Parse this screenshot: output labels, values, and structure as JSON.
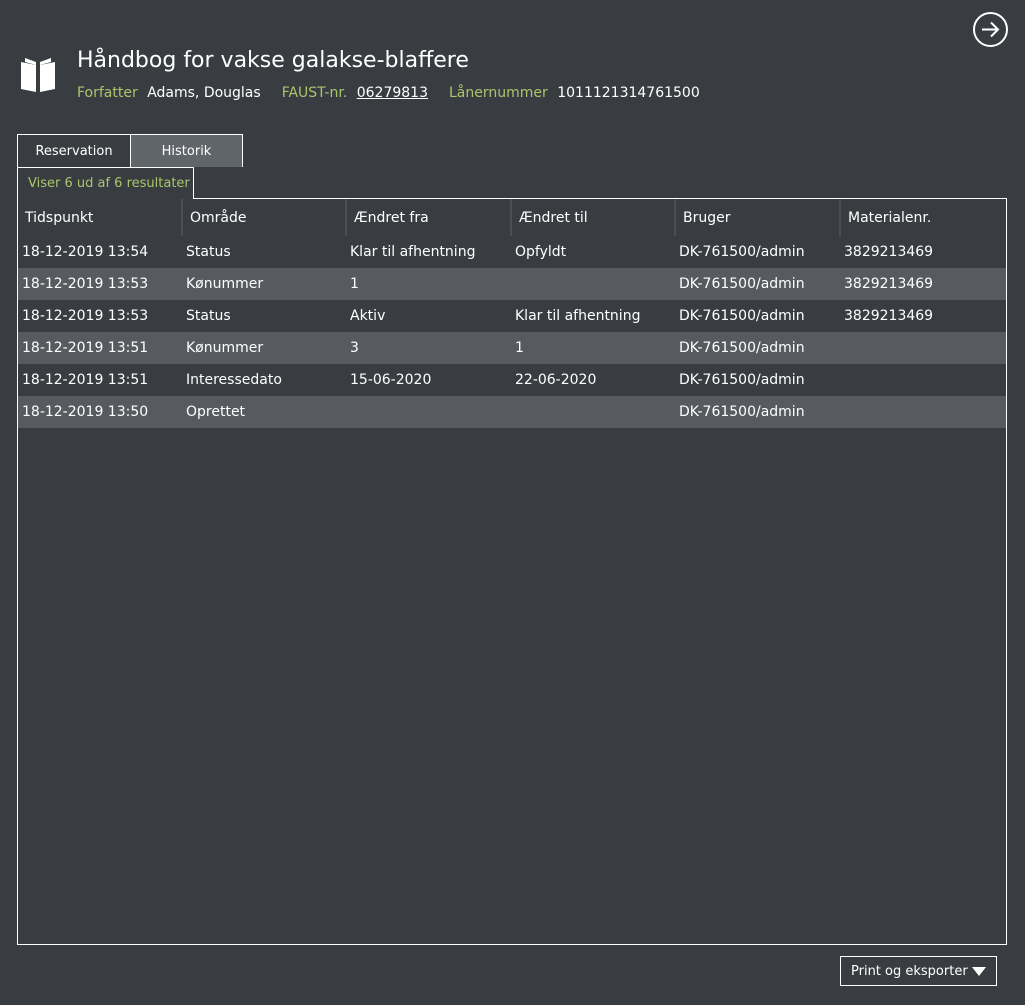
{
  "header": {
    "title": "Håndbog for vakse galakse-blaffere",
    "author_label": "Forfatter",
    "author_value": "Adams, Douglas",
    "faust_label": "FAUST-nr.",
    "faust_value": "06279813",
    "borrower_label": "Lånernummer",
    "borrower_value": "1011121314761500"
  },
  "icons": {
    "book": "open-book-icon",
    "exit": "arrow-right-circle-icon",
    "dropdown": "caret-down-icon"
  },
  "tabs": [
    {
      "label": "Reservation",
      "active": false
    },
    {
      "label": "Historik",
      "active": true
    }
  ],
  "results_text": "Viser 6 ud af 6 resultater",
  "table": {
    "columns": [
      "Tidspunkt",
      "Område",
      "Ændret fra",
      "Ændret til",
      "Bruger",
      "Materialenr."
    ],
    "rows": [
      [
        "18-12-2019 13:54",
        "Status",
        "Klar til afhentning",
        "Opfyldt",
        "DK-761500/admin",
        "3829213469"
      ],
      [
        "18-12-2019 13:53",
        "Kønummer",
        "1",
        "",
        "DK-761500/admin",
        "3829213469"
      ],
      [
        "18-12-2019 13:53",
        "Status",
        "Aktiv",
        "Klar til afhentning",
        "DK-761500/admin",
        "3829213469"
      ],
      [
        "18-12-2019 13:51",
        "Kønummer",
        "3",
        "1",
        "DK-761500/admin",
        ""
      ],
      [
        "18-12-2019 13:51",
        "Interessedato",
        "15-06-2020",
        "22-06-2020",
        "DK-761500/admin",
        ""
      ],
      [
        "18-12-2019 13:50",
        "Oprettet",
        "",
        "",
        "DK-761500/admin",
        ""
      ]
    ]
  },
  "footer": {
    "print_label": "Print og eksporter"
  },
  "colors": {
    "background": "#393d41",
    "accent_label": "#a8c66c",
    "row_alt": "#575b60",
    "tab_active": "#60656a"
  }
}
